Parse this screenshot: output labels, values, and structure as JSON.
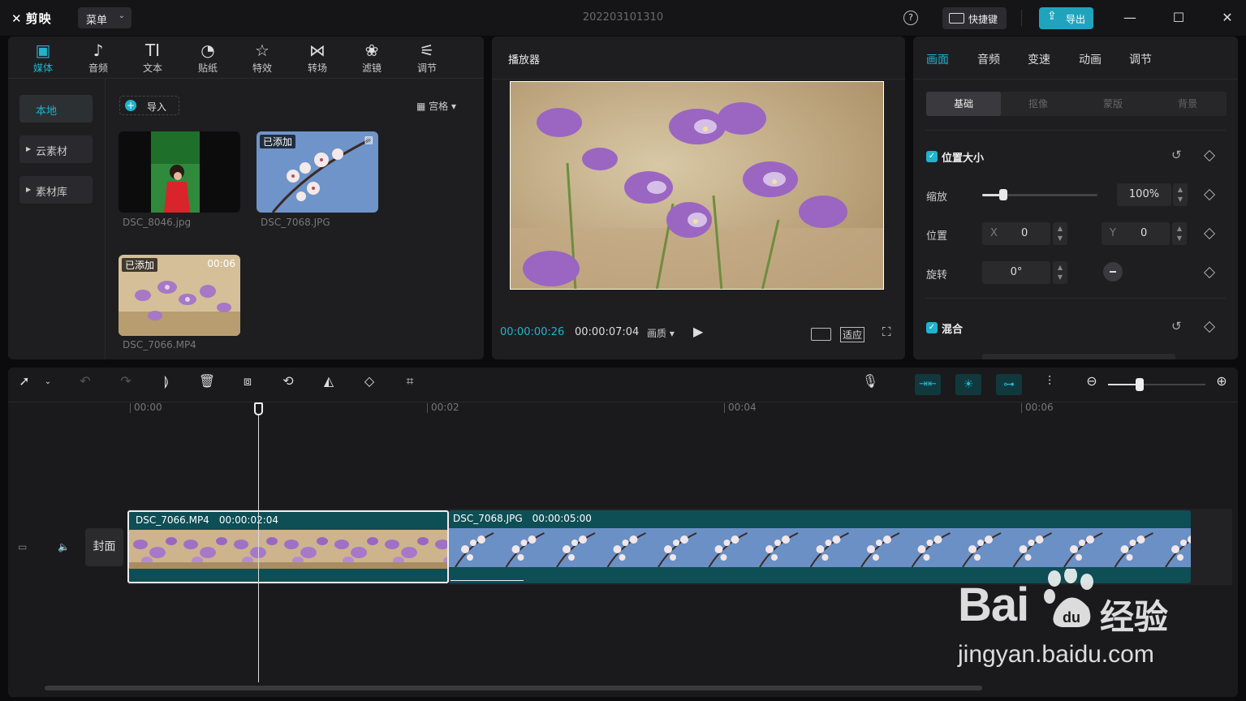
{
  "app": {
    "logo": "剪映",
    "menu": "菜单",
    "project_title": "202203101310",
    "help": "?",
    "shortcut": "快捷键",
    "export": "导出"
  },
  "media_tabs": [
    {
      "label": "媒体",
      "icon": "media-icon",
      "active": true
    },
    {
      "label": "音频",
      "icon": "audio-icon"
    },
    {
      "label": "文本",
      "icon": "text-icon"
    },
    {
      "label": "贴纸",
      "icon": "sticker-icon"
    },
    {
      "label": "特效",
      "icon": "effects-icon"
    },
    {
      "label": "转场",
      "icon": "transition-icon"
    },
    {
      "label": "滤镜",
      "icon": "filter-icon"
    },
    {
      "label": "调节",
      "icon": "adjust-icon"
    }
  ],
  "sidebar": {
    "local": "本地",
    "cloud": "云素材",
    "library": "素材库"
  },
  "media": {
    "import": "导入",
    "view": "宫格",
    "items": [
      {
        "name": "DSC_8046.jpg",
        "badge": "",
        "duration": ""
      },
      {
        "name": "DSC_7068.JPG",
        "badge": "已添加",
        "duration": ""
      },
      {
        "name": "DSC_7066.MP4",
        "badge": "已添加",
        "duration": "00:06"
      }
    ]
  },
  "player": {
    "title": "播放器",
    "current": "00:00:00:26",
    "total": "00:00:07:04",
    "quality": "画质",
    "fit": "适应"
  },
  "props": {
    "tabs": [
      "画面",
      "音频",
      "变速",
      "动画",
      "调节"
    ],
    "subtabs": [
      "基础",
      "抠像",
      "蒙版",
      "背景"
    ],
    "section1": "位置大小",
    "scale_label": "缩放",
    "scale_value": "100%",
    "scale_level": 0.18,
    "position_label": "位置",
    "x_label": "X",
    "x_value": "0",
    "y_label": "Y",
    "y_value": "0",
    "rotate_label": "旋转",
    "rotate_value": "0°",
    "section2": "混合"
  },
  "timeline": {
    "ruler": [
      "00:00",
      "00:02",
      "00:04",
      "00:06"
    ],
    "cover": "封面",
    "clips": [
      {
        "name": "DSC_7066.MP4",
        "duration": "00:00:02:04"
      },
      {
        "name": "DSC_7068.JPG",
        "duration": "00:00:05:00"
      }
    ]
  },
  "watermark": {
    "brand": "Bai",
    "cn": "经验",
    "url": "jingyan.baidu.com"
  },
  "colors": {
    "accent": "#20b3cc",
    "clip": "#0e4e55"
  }
}
